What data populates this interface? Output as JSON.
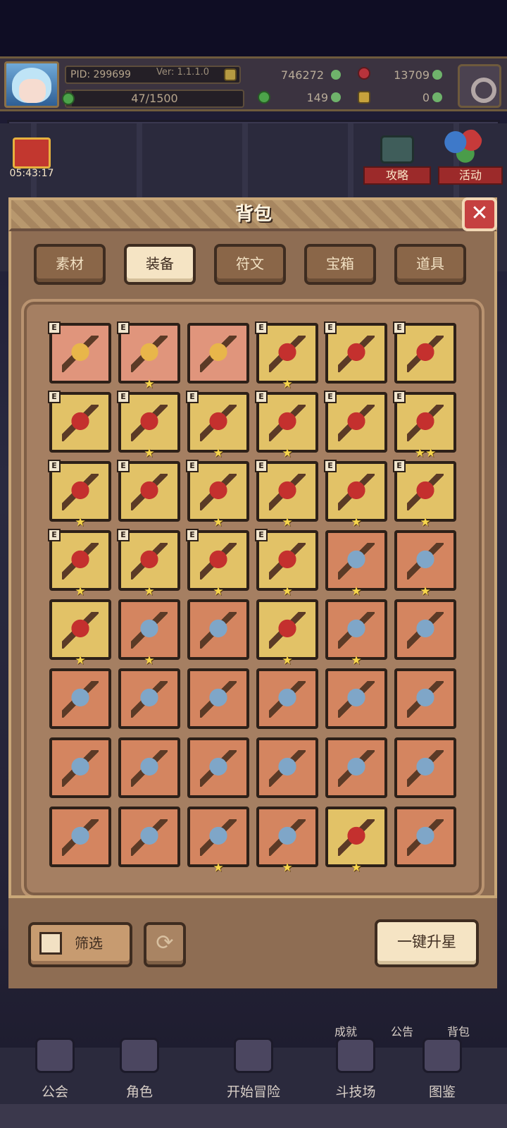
{
  "status": {
    "pid": "PID: 299699",
    "version": "Ver: 1.1.1.0",
    "level_progress": "47/1500",
    "level_fraction": 0.031,
    "currency_gold": "746272",
    "currency_gems": "13709",
    "currency_clover": "149",
    "currency_key": "0"
  },
  "side": {
    "timer": "05:43:17",
    "guide_label": "攻略",
    "event_label": "活动"
  },
  "panel": {
    "title": "背包",
    "close_label": "✕",
    "tabs": [
      {
        "label": "素材",
        "active": false
      },
      {
        "label": "装备",
        "active": true
      },
      {
        "label": "符文",
        "active": false
      },
      {
        "label": "宝箱",
        "active": false
      },
      {
        "label": "道具",
        "active": false
      }
    ],
    "filter_label": "筛选",
    "upgrade_label": "一键升星"
  },
  "inventory": [
    {
      "icon": "hat-icon",
      "bg": "pink",
      "e": true,
      "stars": 0
    },
    {
      "icon": "helmet-icon",
      "bg": "pink",
      "e": true,
      "stars": 1
    },
    {
      "icon": "crown-helmet-icon",
      "bg": "pink",
      "e": false,
      "stars": 0
    },
    {
      "icon": "ice-staff-icon",
      "bg": "gold",
      "e": true,
      "stars": 1
    },
    {
      "icon": "golden-mace-icon",
      "bg": "gold",
      "e": true,
      "stars": 0
    },
    {
      "icon": "blue-shield-icon",
      "bg": "gold",
      "e": true,
      "stars": 0
    },
    {
      "icon": "winged-shield-icon",
      "bg": "gold",
      "e": true,
      "stars": 0
    },
    {
      "icon": "hood-icon",
      "bg": "gold",
      "e": true,
      "stars": 1
    },
    {
      "icon": "royal-shield-icon",
      "bg": "gold",
      "e": true,
      "stars": 1
    },
    {
      "icon": "chest-armor-icon",
      "bg": "gold",
      "e": true,
      "stars": 1
    },
    {
      "icon": "cape-armor-icon",
      "bg": "gold",
      "e": true,
      "stars": 0
    },
    {
      "icon": "gauntlet-icon",
      "bg": "gold",
      "e": true,
      "stars": 2
    },
    {
      "icon": "eye-shield-icon",
      "bg": "gold",
      "e": true,
      "stars": 1
    },
    {
      "icon": "bracer-icon",
      "bg": "gold",
      "e": true,
      "stars": 0
    },
    {
      "icon": "belt-icon",
      "bg": "gold",
      "e": true,
      "stars": 1
    },
    {
      "icon": "ring-icon",
      "bg": "gold",
      "e": true,
      "stars": 1
    },
    {
      "icon": "boots-icon",
      "bg": "gold",
      "e": true,
      "stars": 1
    },
    {
      "icon": "greaves-icon",
      "bg": "gold",
      "e": true,
      "stars": 1
    },
    {
      "icon": "ruby-amulet-icon",
      "bg": "gold",
      "e": true,
      "stars": 1
    },
    {
      "icon": "sapphire-necklace-icon",
      "bg": "gold",
      "e": true,
      "stars": 1
    },
    {
      "icon": "emerald-necklace-icon",
      "bg": "gold",
      "e": true,
      "stars": 1
    },
    {
      "icon": "gold-necklace-icon",
      "bg": "gold",
      "e": true,
      "stars": 1
    },
    {
      "icon": "ice-sword-icon",
      "bg": "orange",
      "e": false,
      "stars": 1
    },
    {
      "icon": "dark-sword-icon",
      "bg": "orange",
      "e": false,
      "stars": 1
    },
    {
      "icon": "golden-scepter-icon",
      "bg": "gold",
      "e": false,
      "stars": 1
    },
    {
      "icon": "axe-icon",
      "bg": "orange",
      "e": false,
      "stars": 1
    },
    {
      "icon": "wooden-staff-icon",
      "bg": "orange",
      "e": false,
      "stars": 0
    },
    {
      "icon": "great-sword-icon",
      "bg": "gold",
      "e": false,
      "stars": 1
    },
    {
      "icon": "serrated-sword-icon",
      "bg": "orange",
      "e": false,
      "stars": 1
    },
    {
      "icon": "jade-bow-icon",
      "bg": "orange",
      "e": false,
      "stars": 0
    },
    {
      "icon": "crossbow-icon",
      "bg": "orange",
      "e": false,
      "stars": 0
    },
    {
      "icon": "dagger-icon",
      "bg": "orange",
      "e": false,
      "stars": 0
    },
    {
      "icon": "orb-staff-icon",
      "bg": "orange",
      "e": false,
      "stars": 0
    },
    {
      "icon": "crystal-wand-icon",
      "bg": "orange",
      "e": false,
      "stars": 0
    },
    {
      "icon": "ivory-bow-icon",
      "bg": "orange",
      "e": false,
      "stars": 0
    },
    {
      "icon": "battle-axe-icon",
      "bg": "orange",
      "e": false,
      "stars": 0
    },
    {
      "icon": "silver-crossbow-icon",
      "bg": "orange",
      "e": false,
      "stars": 0
    },
    {
      "icon": "claw-staff-icon",
      "bg": "orange",
      "e": false,
      "stars": 0
    },
    {
      "icon": "green-mace-icon",
      "bg": "orange",
      "e": false,
      "stars": 0
    },
    {
      "icon": "trident-icon",
      "bg": "orange",
      "e": false,
      "stars": 0
    },
    {
      "icon": "hook-staff-icon",
      "bg": "orange",
      "e": false,
      "stars": 0
    },
    {
      "icon": "teal-club-icon",
      "bg": "orange",
      "e": false,
      "stars": 0
    },
    {
      "icon": "fire-sword-icon",
      "bg": "orange",
      "e": false,
      "stars": 0
    },
    {
      "icon": "blue-scepter-icon",
      "bg": "orange",
      "e": false,
      "stars": 0
    },
    {
      "icon": "spear-icon",
      "bg": "orange",
      "e": false,
      "stars": 1
    },
    {
      "icon": "arrow-icon",
      "bg": "orange",
      "e": false,
      "stars": 1
    },
    {
      "icon": "pearl-orb-icon",
      "bg": "gold",
      "e": false,
      "stars": 1
    },
    {
      "icon": "teddy-bear-icon",
      "bg": "orange",
      "e": false,
      "stars": 0
    }
  ],
  "behind": {
    "achievement": "成就",
    "notice": "公告",
    "bag": "背包"
  },
  "nav": [
    {
      "label": "公会",
      "icon": "guild-icon"
    },
    {
      "label": "角色",
      "icon": "character-icon"
    },
    {
      "label": "开始冒险",
      "icon": "adventure-icon"
    },
    {
      "label": "斗技场",
      "icon": "arena-icon"
    },
    {
      "label": "图鉴",
      "icon": "codex-icon"
    }
  ],
  "colors": {
    "pink_slot": "#e0957c",
    "gold_slot": "#e2c267",
    "orange_slot": "#d48560",
    "panel": "#8e6d53",
    "panel_border": "#c9a778"
  }
}
